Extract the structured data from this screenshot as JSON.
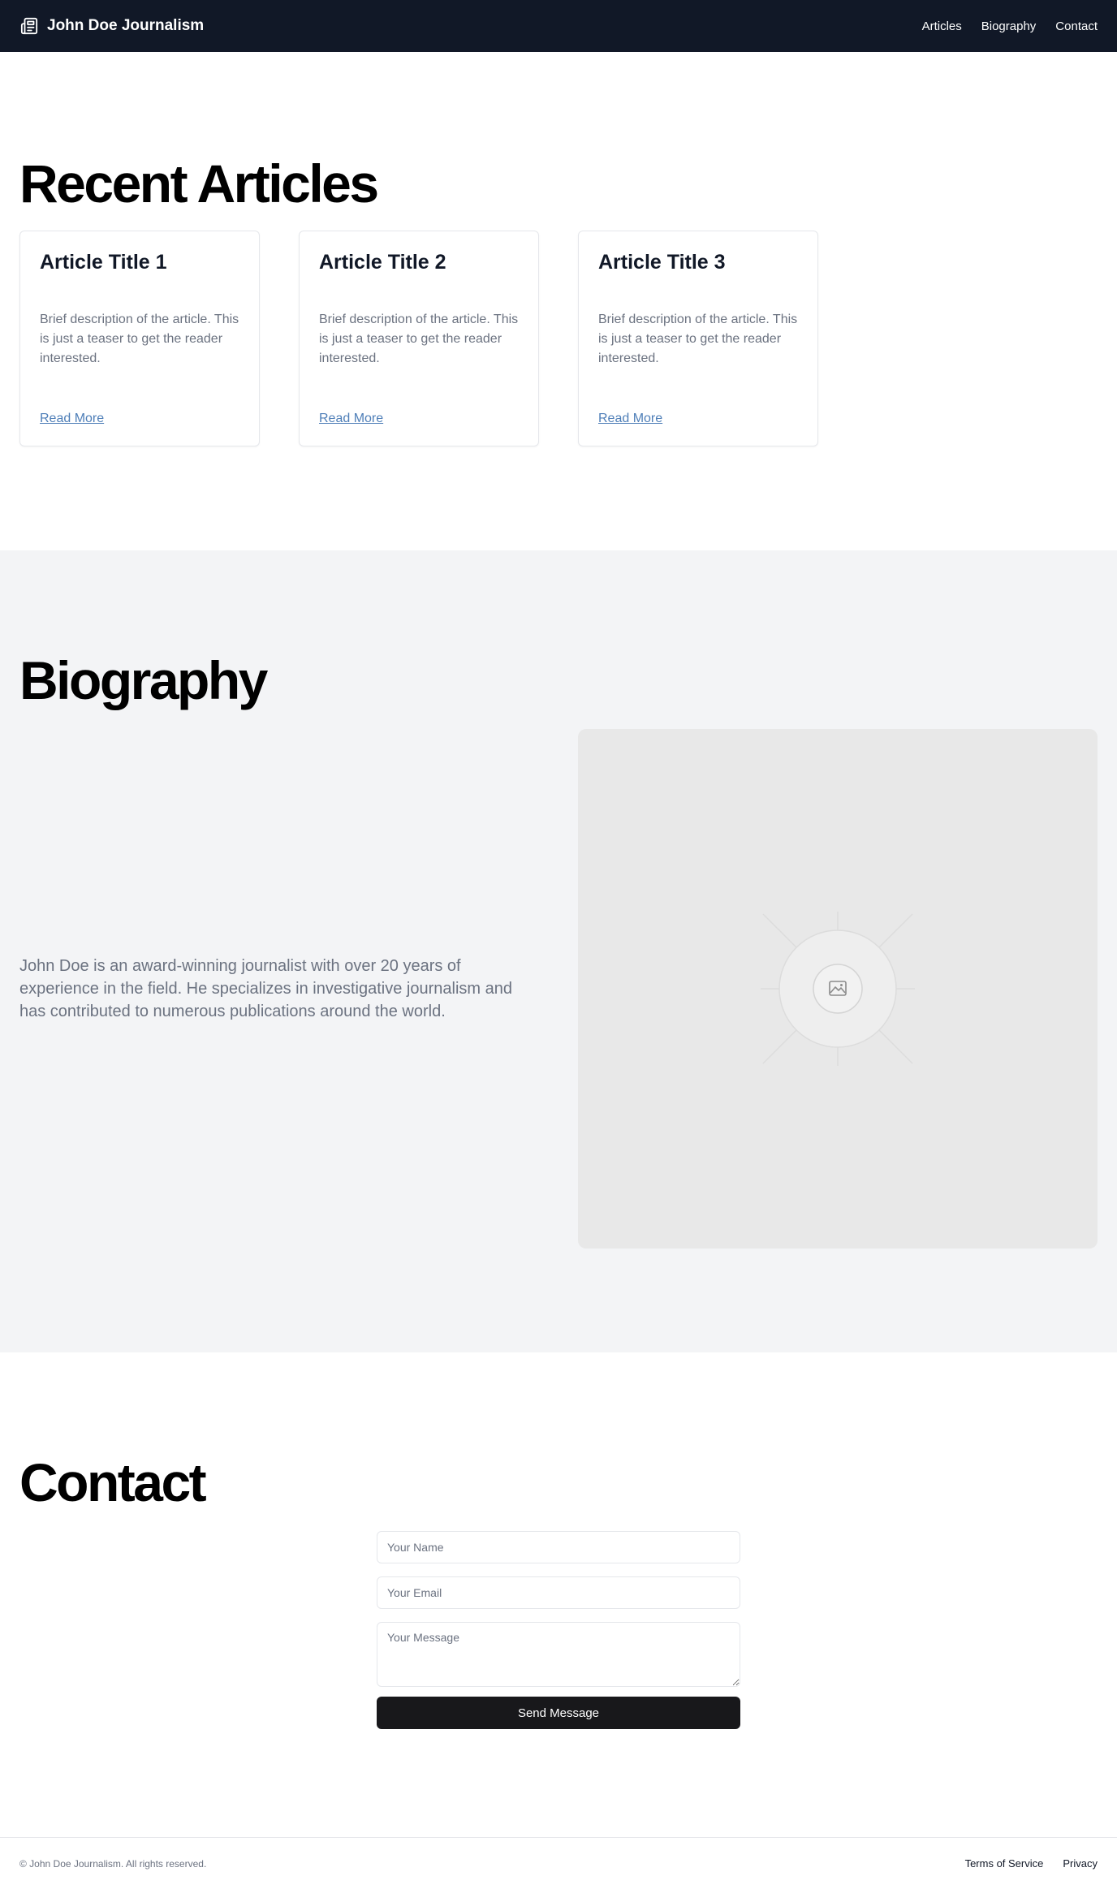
{
  "header": {
    "brand_icon": "newspaper-icon",
    "title": "John Doe Journalism",
    "nav": [
      {
        "label": "Articles"
      },
      {
        "label": "Biography"
      },
      {
        "label": "Contact"
      }
    ]
  },
  "articles": {
    "heading": "Recent Articles",
    "items": [
      {
        "title": "Article Title 1",
        "description": "Brief description of the article. This is just a teaser to get the reader interested.",
        "link": "Read More"
      },
      {
        "title": "Article Title 2",
        "description": "Brief description of the article. This is just a teaser to get the reader interested.",
        "link": "Read More"
      },
      {
        "title": "Article Title 3",
        "description": "Brief description of the article. This is just a teaser to get the reader interested.",
        "link": "Read More"
      }
    ]
  },
  "biography": {
    "heading": "Biography",
    "text": "John Doe is an award-winning journalist with over 20 years of experience in the field. He specializes in investigative journalism and has contributed to numerous publications around the world.",
    "image_icon": "image-placeholder-icon"
  },
  "contact": {
    "heading": "Contact",
    "name_placeholder": "Your Name",
    "email_placeholder": "Your Email",
    "message_placeholder": "Your Message",
    "submit_label": "Send Message"
  },
  "footer": {
    "copyright": "© John Doe Journalism. All rights reserved.",
    "links": [
      {
        "label": "Terms of Service"
      },
      {
        "label": "Privacy"
      }
    ]
  },
  "colors": {
    "header_bg": "#111827",
    "section_alt_bg": "#f3f4f6",
    "link": "#4f7fb8",
    "button_bg": "#18181b"
  }
}
